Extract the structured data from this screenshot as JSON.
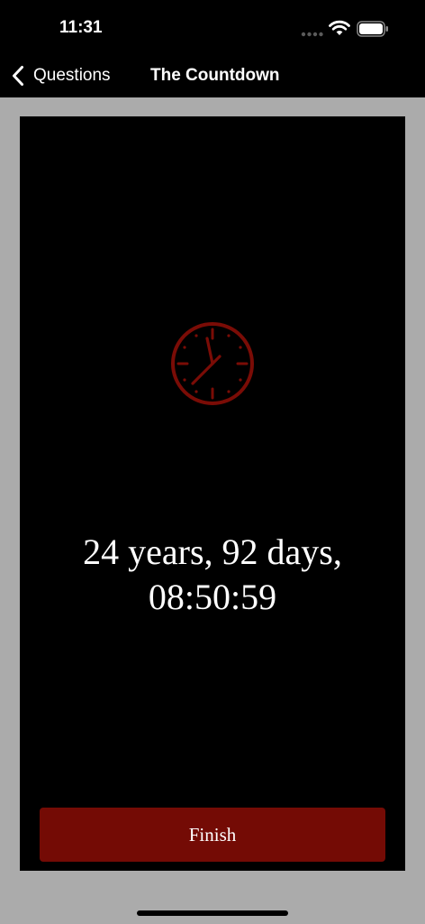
{
  "status_bar": {
    "time": "11:31",
    "icons": [
      "signal-dots-icon",
      "wifi-icon",
      "battery-icon"
    ]
  },
  "nav": {
    "back_label": "Questions",
    "title": "The Countdown"
  },
  "main": {
    "icon": "clock-icon",
    "countdown_line1": "24 years, 92 days,",
    "countdown_line2": "08:50:59",
    "finish_label": "Finish"
  },
  "colors": {
    "accent": "#740b05",
    "clock": "#7a0c06",
    "background": "#000000",
    "frame": "#ababab"
  }
}
